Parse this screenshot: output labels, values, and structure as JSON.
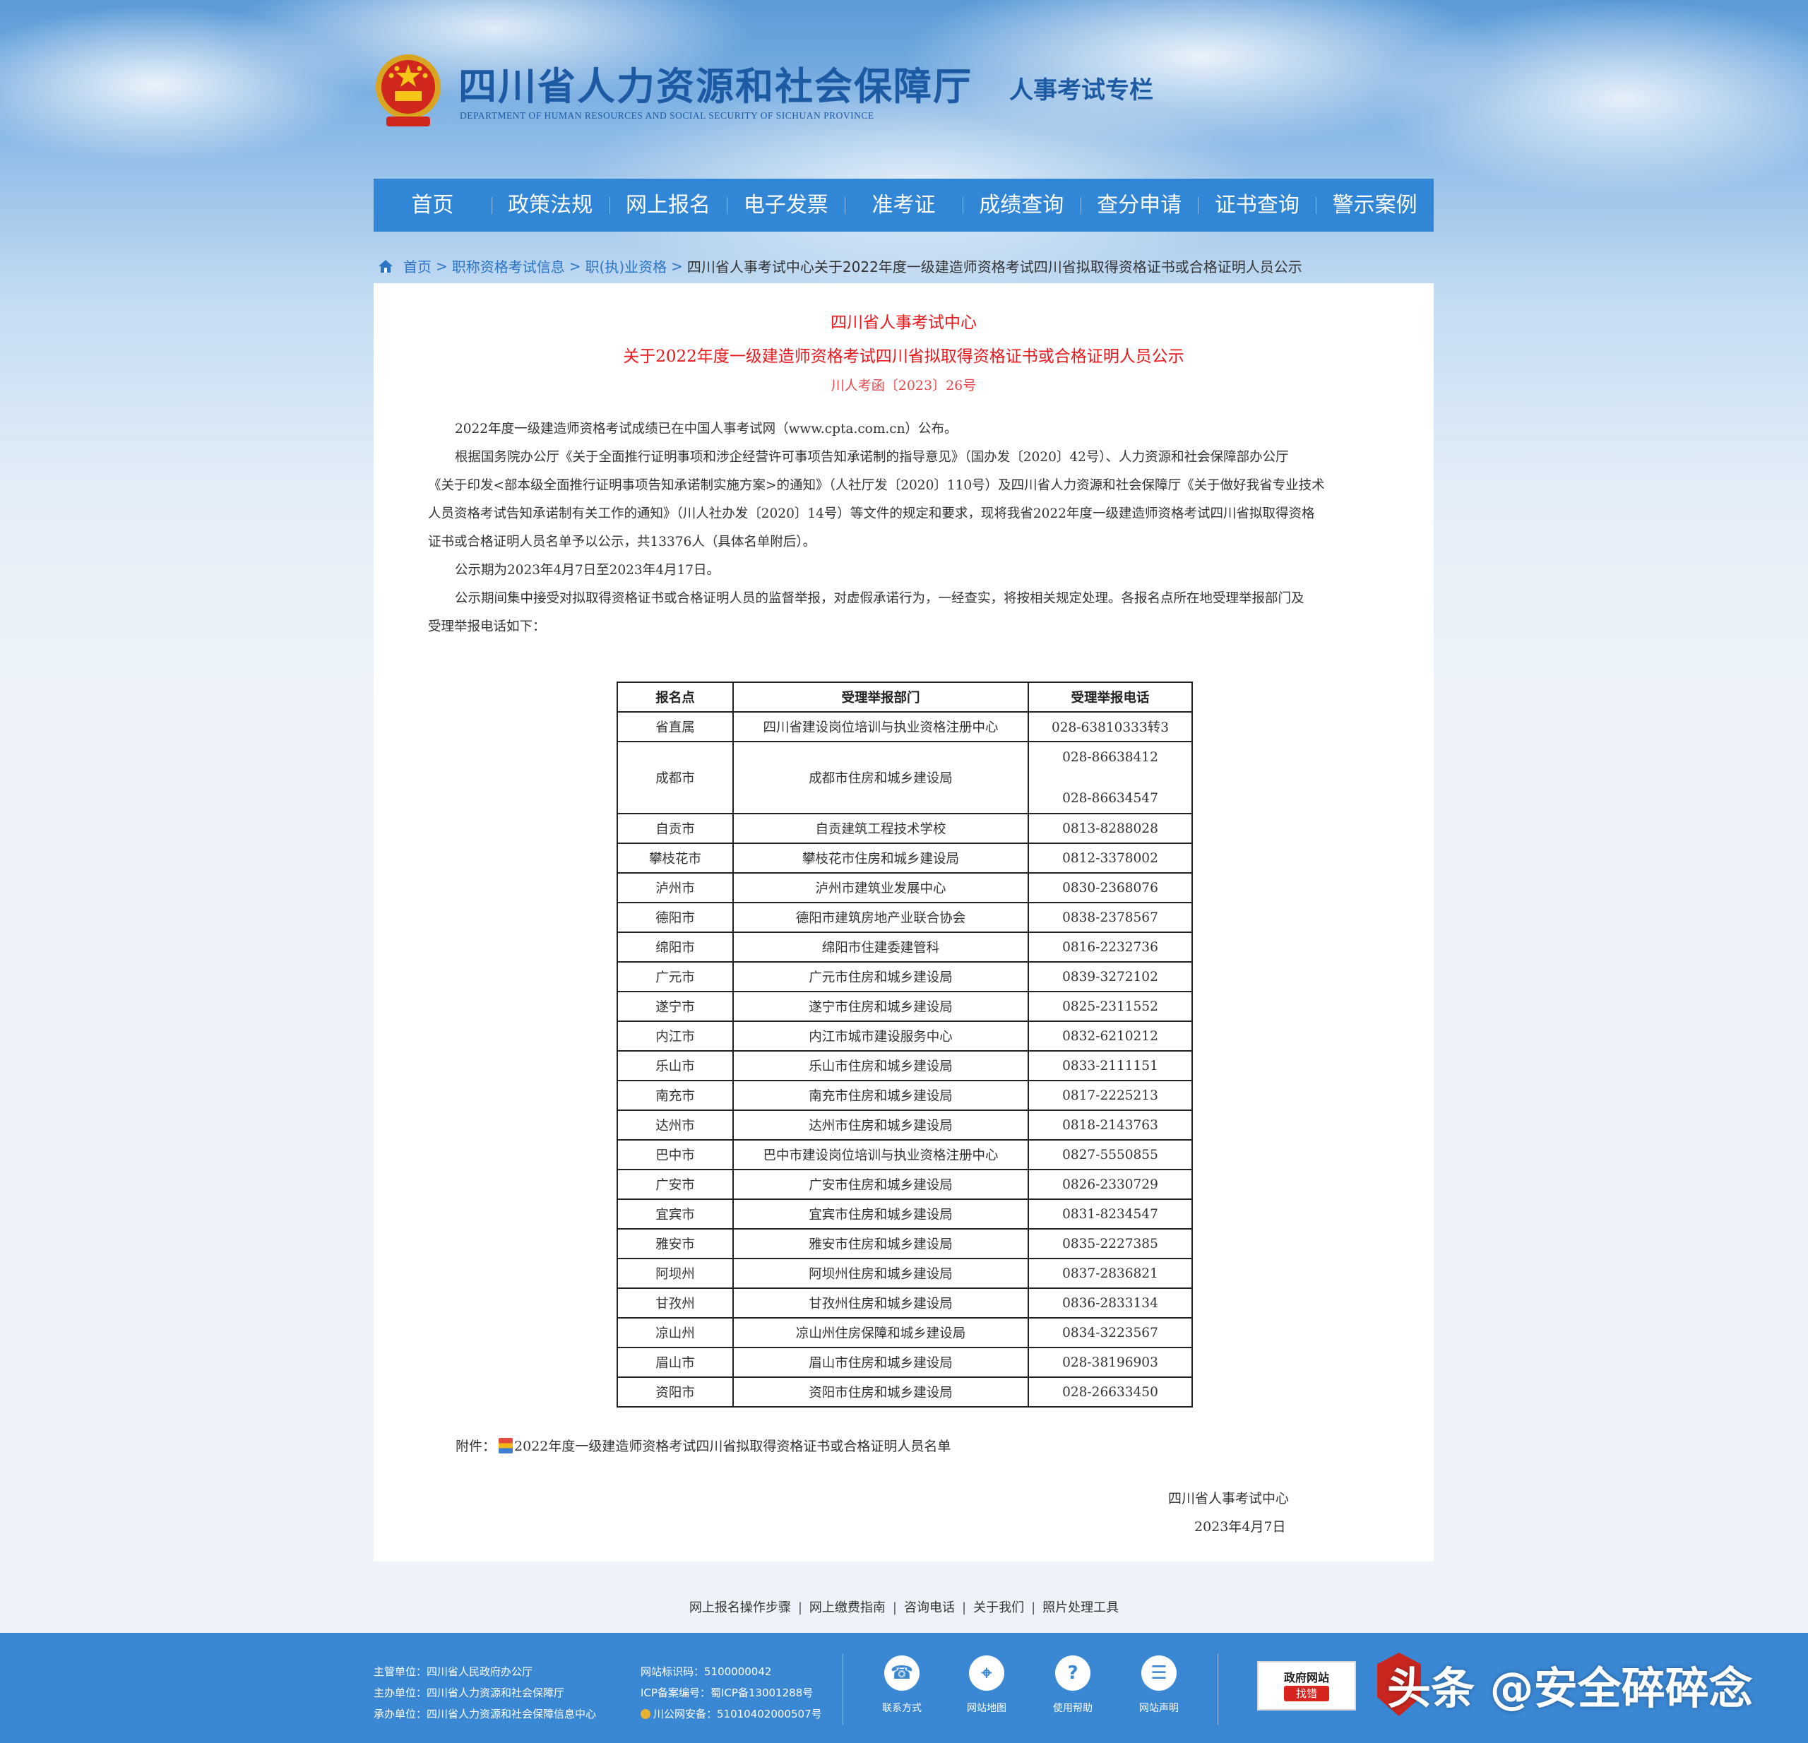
{
  "header": {
    "title": "四川省人力资源和社会保障厅",
    "subtitle": "DEPARTMENT OF HUMAN RESOURCES AND SOCIAL SECURITY OF SICHUAN PROVINCE",
    "column": "人事考试专栏"
  },
  "nav": [
    "首页",
    "政策法规",
    "网上报名",
    "电子发票",
    "准考证",
    "成绩查询",
    "查分申请",
    "证书查询",
    "警示案例"
  ],
  "breadcrumb": {
    "home": "首页",
    "level1": "职称资格考试信息",
    "level2": "职(执)业资格",
    "current": "四川省人事考试中心关于2022年度一级建造师资格考试四川省拟取得资格证书或合格证明人员公示"
  },
  "article": {
    "org": "四川省人事考试中心",
    "title": "关于2022年度一级建造师资格考试四川省拟取得资格证书或合格证明人员公示",
    "doc_no": "川人考函〔2023〕26号",
    "p1": "2022年度一级建造师资格考试成绩已在中国人事考试网（www.cpta.com.cn）公布。",
    "p2_line1": "根据国务院办公厅《关于全面推行证明事项和涉企经营许可事项告知承诺制的指导意见》（国办发〔2020〕42号）、人力资源和社会保障部办公厅",
    "p2_line2": "《关于印发<部本级全面推行证明事项告知承诺制实施方案>的通知》（人社厅发〔2020〕110号）及四川省人力资源和社会保障厅《关于做好我省专业技术",
    "p2_line3": "人员资格考试告知承诺制有关工作的通知》（川人社办发〔2020〕14号）等文件的规定和要求，现将我省2022年度一级建造师资格考试四川省拟取得资格",
    "p2_line4": "证书或合格证明人员名单予以公示，共13376人（具体名单附后）。",
    "p3": "公示期为2023年4月7日至2023年4月17日。",
    "p4_line1": "公示期间集中接受对拟取得资格证书或合格证明人员的监督举报，对虚假承诺行为，一经查实，将按相关规定处理。各报名点所在地受理举报部门及",
    "p4_line2": "受理举报电话如下：",
    "attachment_label": "附件：",
    "attachment_name": "2022年度一级建造师资格考试四川省拟取得资格证书或合格证明人员名单",
    "sign_org": "四川省人事考试中心",
    "sign_date": "2023年4月7日"
  },
  "table": {
    "headers": [
      "报名点",
      "受理举报部门",
      "受理举报电话"
    ],
    "rows": [
      [
        "省直属",
        "四川省建设岗位培训与执业资格注册中心",
        "028-63810333转3"
      ],
      [
        "成都市",
        "成都市住房和城乡建设局",
        "028-86638412",
        "028-86634547"
      ],
      [
        "自贡市",
        "自贡建筑工程技术学校",
        "0813-8288028"
      ],
      [
        "攀枝花市",
        "攀枝花市住房和城乡建设局",
        "0812-3378002"
      ],
      [
        "泸州市",
        "泸州市建筑业发展中心",
        "0830-2368076"
      ],
      [
        "德阳市",
        "德阳市建筑房地产业联合协会",
        "0838-2378567"
      ],
      [
        "绵阳市",
        "绵阳市住建委建管科",
        "0816-2232736"
      ],
      [
        "广元市",
        "广元市住房和城乡建设局",
        "0839-3272102"
      ],
      [
        "遂宁市",
        "遂宁市住房和城乡建设局",
        "0825-2311552"
      ],
      [
        "内江市",
        "内江市城市建设服务中心",
        "0832-6210212"
      ],
      [
        "乐山市",
        "乐山市住房和城乡建设局",
        "0833-2111151"
      ],
      [
        "南充市",
        "南充市住房和城乡建设局",
        "0817-2225213"
      ],
      [
        "达州市",
        "达州市住房和城乡建设局",
        "0818-2143763"
      ],
      [
        "巴中市",
        "巴中市建设岗位培训与执业资格注册中心",
        "0827-5550855"
      ],
      [
        "广安市",
        "广安市住房和城乡建设局",
        "0826-2330729"
      ],
      [
        "宜宾市",
        "宜宾市住房和城乡建设局",
        "0831-8234547"
      ],
      [
        "雅安市",
        "雅安市住房和城乡建设局",
        "0835-2227385"
      ],
      [
        "阿坝州",
        "阿坝州住房和城乡建设局",
        "0837-2836821"
      ],
      [
        "甘孜州",
        "甘孜州住房和城乡建设局",
        "0836-2833134"
      ],
      [
        "凉山州",
        "凉山州住房保障和城乡建设局",
        "0834-3223567"
      ],
      [
        "眉山市",
        "眉山市住房和城乡建设局",
        "028-38196903"
      ],
      [
        "资阳市",
        "资阳市住房和城乡建设局",
        "028-26633450"
      ]
    ]
  },
  "footer_links": [
    "网上报名操作步骤",
    "网上缴费指南",
    "咨询电话",
    "关于我们",
    "照片处理工具"
  ],
  "footer": {
    "host": "主管单位：四川省人民政府办公厅",
    "sponsor": "主办单位：四川省人力资源和社会保障厅",
    "undertaker": "承办单位：四川省人力资源和社会保障信息中心",
    "site_id": "网站标识码：5100000042",
    "icp": "ICP备案编号：蜀ICP备13001288号",
    "police": "川公网安备：51010402000507号",
    "icons": [
      "联系方式",
      "网站地图",
      "使用帮助",
      "网站声明"
    ],
    "badge_line1": "政府网站",
    "badge_line2": "找错"
  },
  "watermark": "头条 @安全碎碎念",
  "colors": {
    "nav": "#3186d6",
    "footer": "#3a87d4",
    "title_red": "#e8181d",
    "link": "#2b75c5"
  }
}
